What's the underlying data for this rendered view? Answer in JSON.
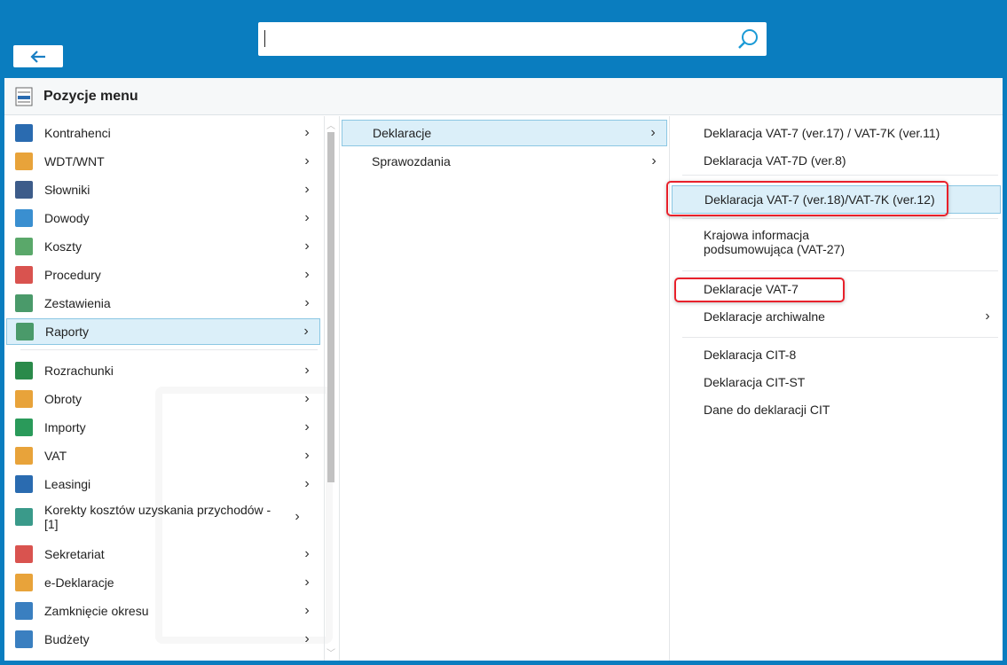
{
  "search": {
    "value": "",
    "placeholder": ""
  },
  "header": {
    "title": "Pozycje menu"
  },
  "column1": {
    "items": [
      {
        "label": "Kontrahenci",
        "color": "#2a6bb0"
      },
      {
        "label": "WDT/WNT",
        "color": "#e8a33a"
      },
      {
        "label": "Słowniki",
        "color": "#3d5c8a"
      },
      {
        "label": "Dowody",
        "color": "#3a8fd0"
      },
      {
        "label": "Koszty",
        "color": "#5aa86a"
      },
      {
        "label": "Procedury",
        "color": "#d9534f"
      },
      {
        "label": "Zestawienia",
        "color": "#4a9a6a"
      },
      {
        "label": "Raporty",
        "color": "#4a9a6a",
        "selected": true
      },
      {
        "label": "Rozrachunki",
        "color": "#2a8a4a"
      },
      {
        "label": "Obroty",
        "color": "#e8a33a"
      },
      {
        "label": "Importy",
        "color": "#2a9a5a"
      },
      {
        "label": "VAT",
        "color": "#e8a33a"
      },
      {
        "label": "Leasingi",
        "color": "#2a6bb0"
      },
      {
        "label": "Korekty kosztów uzyskania przychodów - [1]",
        "color": "#3a9a8a"
      },
      {
        "label": "Sekretariat",
        "color": "#d9534f"
      },
      {
        "label": "e-Deklaracje",
        "color": "#e8a33a"
      },
      {
        "label": "Zamknięcie okresu",
        "color": "#3a7fc0"
      },
      {
        "label": "Budżety",
        "color": "#3a7fc0"
      }
    ]
  },
  "column2": {
    "items": [
      {
        "label": "Deklaracje",
        "selected": true
      },
      {
        "label": "Sprawozdania"
      }
    ]
  },
  "column3": {
    "items": [
      {
        "label": "Deklaracja VAT-7 (ver.17) / VAT-7K (ver.11)"
      },
      {
        "label": "Deklaracja VAT-7D (ver.8)"
      },
      {
        "label": "Deklaracja VAT-7 (ver.18)/VAT-7K (ver.12)",
        "selected": true
      },
      {
        "label": "Krajowa informacja podsumowująca (VAT-27)"
      },
      {
        "label": "Deklaracje VAT-7"
      },
      {
        "label": "Deklaracje archiwalne",
        "submenu": true
      },
      {
        "label": "Deklaracja CIT-8"
      },
      {
        "label": "Deklaracja CIT-ST"
      },
      {
        "label": "Dane do deklaracji CIT"
      }
    ]
  },
  "chevron": "›",
  "colors": {
    "accent": "#0a7dbf",
    "selection": "#dbeff9",
    "highlight": "#e8212b"
  }
}
